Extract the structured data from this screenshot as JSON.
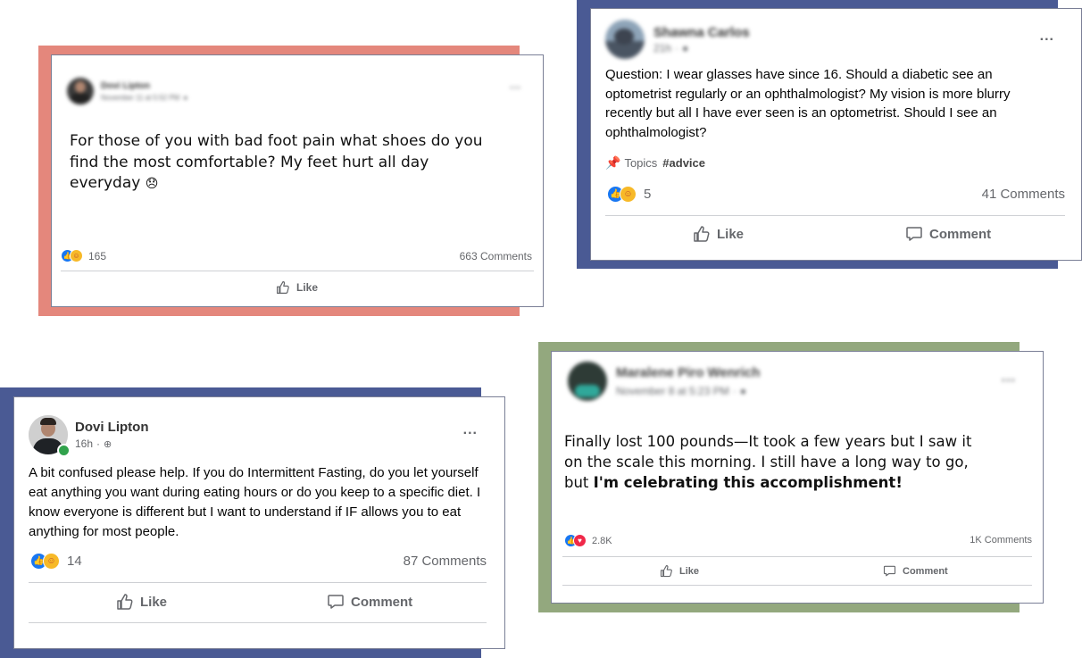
{
  "colors": {
    "salmon": "#e4877c",
    "navy": "#4a5a94",
    "sage": "#93a87e",
    "fb_blue": "#1877f2"
  },
  "posts": [
    {
      "author": "Dovi Lipton",
      "time": "November 11 at 5:52 PM",
      "text": "For those of you with bad foot pain what shoes do you find the most comfortable? My feet hurt all day everyday",
      "emoji": "😞",
      "reaction_count": "165",
      "comments": "663 Comments",
      "like_label": "Like",
      "menu": "..."
    },
    {
      "author": "Shawna Carlos",
      "time": "21h",
      "text": "Question: I wear glasses have since 16. Should a diabetic see an optometrist regularly or an ophthalmologist? My vision is more blurry recently but all I have ever seen is an optometrist. Should I see an ophthalmologist?",
      "topics_label": "Topics",
      "topic_tag": "#advice",
      "reaction_count": "5",
      "comments": "41 Comments",
      "like_label": "Like",
      "comment_label": "Comment",
      "menu": "..."
    },
    {
      "author": "Dovi Lipton",
      "time": "16h",
      "text": "A bit confused please help. If you do Intermittent Fasting, do you let yourself eat anything you want during eating hours or do you keep to a specific diet. I know everyone is different but I want to understand if IF allows you to eat anything for most people.",
      "reaction_count": "14",
      "comments": "87 Comments",
      "like_label": "Like",
      "comment_label": "Comment",
      "menu": "..."
    },
    {
      "author": "Maralene Piro Wenrich",
      "time": "November 8 at 5:23 PM",
      "text_plain": "Finally lost 100 pounds—It took a few years but I saw it on the scale this morning. I still have a long way to go, but ",
      "text_bold": "I'm celebrating this accomplishment!",
      "reaction_count": "2.8K",
      "comments": "1K Comments",
      "like_label": "Like",
      "comment_label": "Comment",
      "menu": "..."
    }
  ]
}
